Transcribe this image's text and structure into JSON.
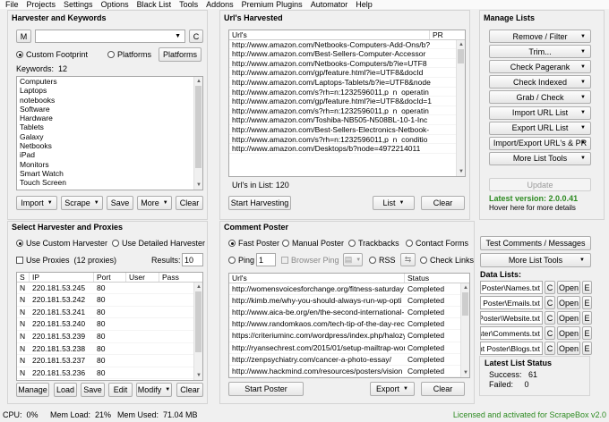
{
  "menu": [
    "File",
    "Projects",
    "Settings",
    "Options",
    "Black List",
    "Tools",
    "Addons",
    "Premium Plugins",
    "Automator",
    "Help"
  ],
  "harvester_keywords": {
    "title": "Harvester and Keywords",
    "m_button": "M",
    "c_button": "C",
    "custom_footprint": "Custom Footprint",
    "platforms_radio": "Platforms",
    "platforms_button": "Platforms",
    "keywords_label": "Keywords:",
    "keywords_count": "12",
    "keywords": [
      "Computers",
      "Laptops",
      "notebooks",
      "Software",
      "Hardware",
      "Tablets",
      "Galaxy",
      "Netbooks",
      "iPad",
      "Monitors",
      "Smart Watch",
      "Touch Screen"
    ],
    "import": "Import",
    "scrape": "Scrape",
    "save": "Save",
    "more": "More",
    "clear": "Clear"
  },
  "urls_harvested": {
    "title": "Url's Harvested",
    "col_url": "Url's",
    "col_pr": "PR",
    "urls": [
      "http://www.amazon.com/Netbooks-Computers-Add-Ons/b?",
      "http://www.amazon.com/Best-Sellers-Computer-Accessor",
      "http://www.amazon.com/Netbooks-Computers/b?ie=UTF8",
      "http://www.amazon.com/gp/feature.html?ie=UTF8&docId",
      "http://www.amazon.com/Laptops-Tablets/b?ie=UTF8&node",
      "http://www.amazon.com/s?rh=n:1232596011,p_n_operatin",
      "http://www.amazon.com/gp/feature.html?ie=UTF8&docId=1",
      "http://www.amazon.com/s?rh=n:1232596011,p_n_operatin",
      "http://www.amazon.com/Toshiba-NB505-N508BL-10-1-Inc",
      "http://www.amazon.com/Best-Sellers-Electronics-Netbook-",
      "http://www.amazon.com/s?rh=n:1232596011,p_n_conditio",
      "http://www.amazon.com/Desktops/b?node=4972214011"
    ],
    "urls_in_list_label": "Url's in List:",
    "urls_in_list_count": "120",
    "start_harvesting": "Start Harvesting",
    "list": "List",
    "clear": "Clear"
  },
  "manage_lists": {
    "title": "Manage Lists",
    "buttons": [
      "Remove / Filter",
      "Trim...",
      "Check Pagerank",
      "Check Indexed",
      "Grab / Check",
      "Import URL List",
      "Export URL List",
      "Import/Export URL's & PR",
      "More List Tools"
    ],
    "update": "Update",
    "latest_version_label": "Latest version:",
    "latest_version": "2.0.0.41",
    "hover_text": "Hover here for more details"
  },
  "proxies": {
    "title": "Select Harvester and Proxies",
    "use_custom": "Use Custom Harvester",
    "use_detailed": "Use Detailed Harvester",
    "use_proxies": "Use Proxies",
    "proxies_count": "(12 proxies)",
    "results_label": "Results:",
    "results_value": "10",
    "col_s": "S",
    "col_ip": "IP",
    "col_port": "Port",
    "col_user": "User",
    "col_pass": "Pass",
    "rows": [
      {
        "s": "N",
        "ip": "220.181.53.245",
        "port": "80"
      },
      {
        "s": "N",
        "ip": "220.181.53.242",
        "port": "80"
      },
      {
        "s": "N",
        "ip": "220.181.53.241",
        "port": "80"
      },
      {
        "s": "N",
        "ip": "220.181.53.240",
        "port": "80"
      },
      {
        "s": "N",
        "ip": "220.181.53.239",
        "port": "80"
      },
      {
        "s": "N",
        "ip": "220.181.53.238",
        "port": "80"
      },
      {
        "s": "N",
        "ip": "220.181.53.237",
        "port": "80"
      },
      {
        "s": "N",
        "ip": "220.181.53.236",
        "port": "80"
      }
    ],
    "manage": "Manage",
    "load": "Load",
    "save": "Save",
    "edit": "Edit",
    "modify": "Modify",
    "clear": "Clear"
  },
  "comment_poster": {
    "title": "Comment Poster",
    "fast_poster": "Fast Poster",
    "manual_poster": "Manual Poster",
    "trackbacks": "Trackbacks",
    "contact_forms": "Contact Forms",
    "ping": "Ping",
    "ping_value": "1",
    "browser_ping": "Browser Ping",
    "rss": "RSS",
    "check_links": "Check Links",
    "col_url": "Url's",
    "col_status": "Status",
    "rows": [
      {
        "url": "http://womensvoicesforchange.org/fitness-saturday",
        "status": "Completed"
      },
      {
        "url": "http://kimb.me/why-you-should-always-run-wp-opti",
        "status": "Completed"
      },
      {
        "url": "http://www.aica-be.org/en/the-second-international-",
        "status": "Completed"
      },
      {
        "url": "http://www.randomkaos.com/tech-tip-of-the-day-rec",
        "status": "Completed"
      },
      {
        "url": "https://criteriuminc.com/wordpress/index.php/halozy",
        "status": "Completed"
      },
      {
        "url": "http://ryansechrest.com/2015/01/setup-mailtrap-wor",
        "status": "Completed"
      },
      {
        "url": "http://zenpsychiatry.com/cancer-a-photo-essay/",
        "status": "Completed"
      },
      {
        "url": "http://www.hackmind.com/resources/posters/vision",
        "status": "Completed"
      }
    ],
    "start_poster": "Start Poster",
    "export": "Export",
    "clear": "Clear",
    "test_comments": "Test Comments / Messages",
    "more_list_tools": "More List Tools"
  },
  "data_lists": {
    "title": "Data Lists:",
    "files": [
      "Poster\\Names.txt",
      "t Poster\\Emails.txt",
      "Poster\\Website.txt",
      "ster\\Comments.txt",
      "nt Poster\\Blogs.txt"
    ],
    "c": "C",
    "open": "Open",
    "e": "E"
  },
  "latest_list_status": {
    "title": "Latest List Status",
    "success_label": "Success:",
    "success_value": "61",
    "failed_label": "Failed:",
    "failed_value": "0"
  },
  "statusbar": {
    "cpu_label": "CPU:",
    "cpu": "0%",
    "mem_load_label": "Mem Load:",
    "mem_load": "21%",
    "mem_used_label": "Mem Used:",
    "mem_used": "71.04 MB",
    "license": "Licensed and activated for ScrapeBox v2.0"
  },
  "colors": {
    "green": "#2e8b22",
    "panel_border": "#d4d4d4"
  }
}
